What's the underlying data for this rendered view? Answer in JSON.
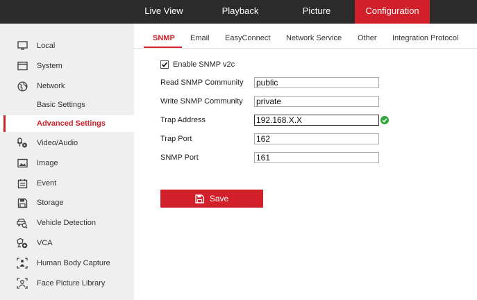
{
  "topnav": {
    "items": [
      {
        "label": "Live View"
      },
      {
        "label": "Playback"
      },
      {
        "label": "Picture"
      },
      {
        "label": "Configuration"
      }
    ],
    "active_color": "#d2202a"
  },
  "sidebar": {
    "items": [
      {
        "label": "Local",
        "icon": "monitor-icon"
      },
      {
        "label": "System",
        "icon": "system-window-icon"
      },
      {
        "label": "Network",
        "icon": "globe-icon"
      },
      {
        "label": "Basic Settings",
        "icon": ""
      },
      {
        "label": "Advanced Settings",
        "icon": ""
      },
      {
        "label": "Video/Audio",
        "icon": "camera-mic-icon"
      },
      {
        "label": "Image",
        "icon": "image-icon"
      },
      {
        "label": "Event",
        "icon": "calendar-icon"
      },
      {
        "label": "Storage",
        "icon": "floppy-icon"
      },
      {
        "label": "Vehicle Detection",
        "icon": "vehicle-search-icon"
      },
      {
        "label": "VCA",
        "icon": "vca-icon"
      },
      {
        "label": "Human Body Capture",
        "icon": "body-capture-icon"
      },
      {
        "label": "Face Picture Library",
        "icon": "face-library-icon"
      }
    ],
    "selected": "Advanced Settings"
  },
  "tabs": {
    "items": [
      {
        "label": "SNMP"
      },
      {
        "label": "Email"
      },
      {
        "label": "EasyConnect"
      },
      {
        "label": "Network Service"
      },
      {
        "label": "Other"
      },
      {
        "label": "Integration Protocol"
      }
    ],
    "active": "SNMP"
  },
  "form": {
    "enable_label": "Enable SNMP v2c",
    "enable_checked": true,
    "fields": [
      {
        "label": "Read SNMP Community",
        "value": "public"
      },
      {
        "label": "Write SNMP Community",
        "value": "private"
      },
      {
        "label": "Trap Address",
        "value": "192.168.X.X"
      },
      {
        "label": "Trap Port",
        "value": "162"
      },
      {
        "label": "SNMP Port",
        "value": "161"
      }
    ],
    "trap_valid_color": "#2eaa3b",
    "save_label": "Save"
  }
}
